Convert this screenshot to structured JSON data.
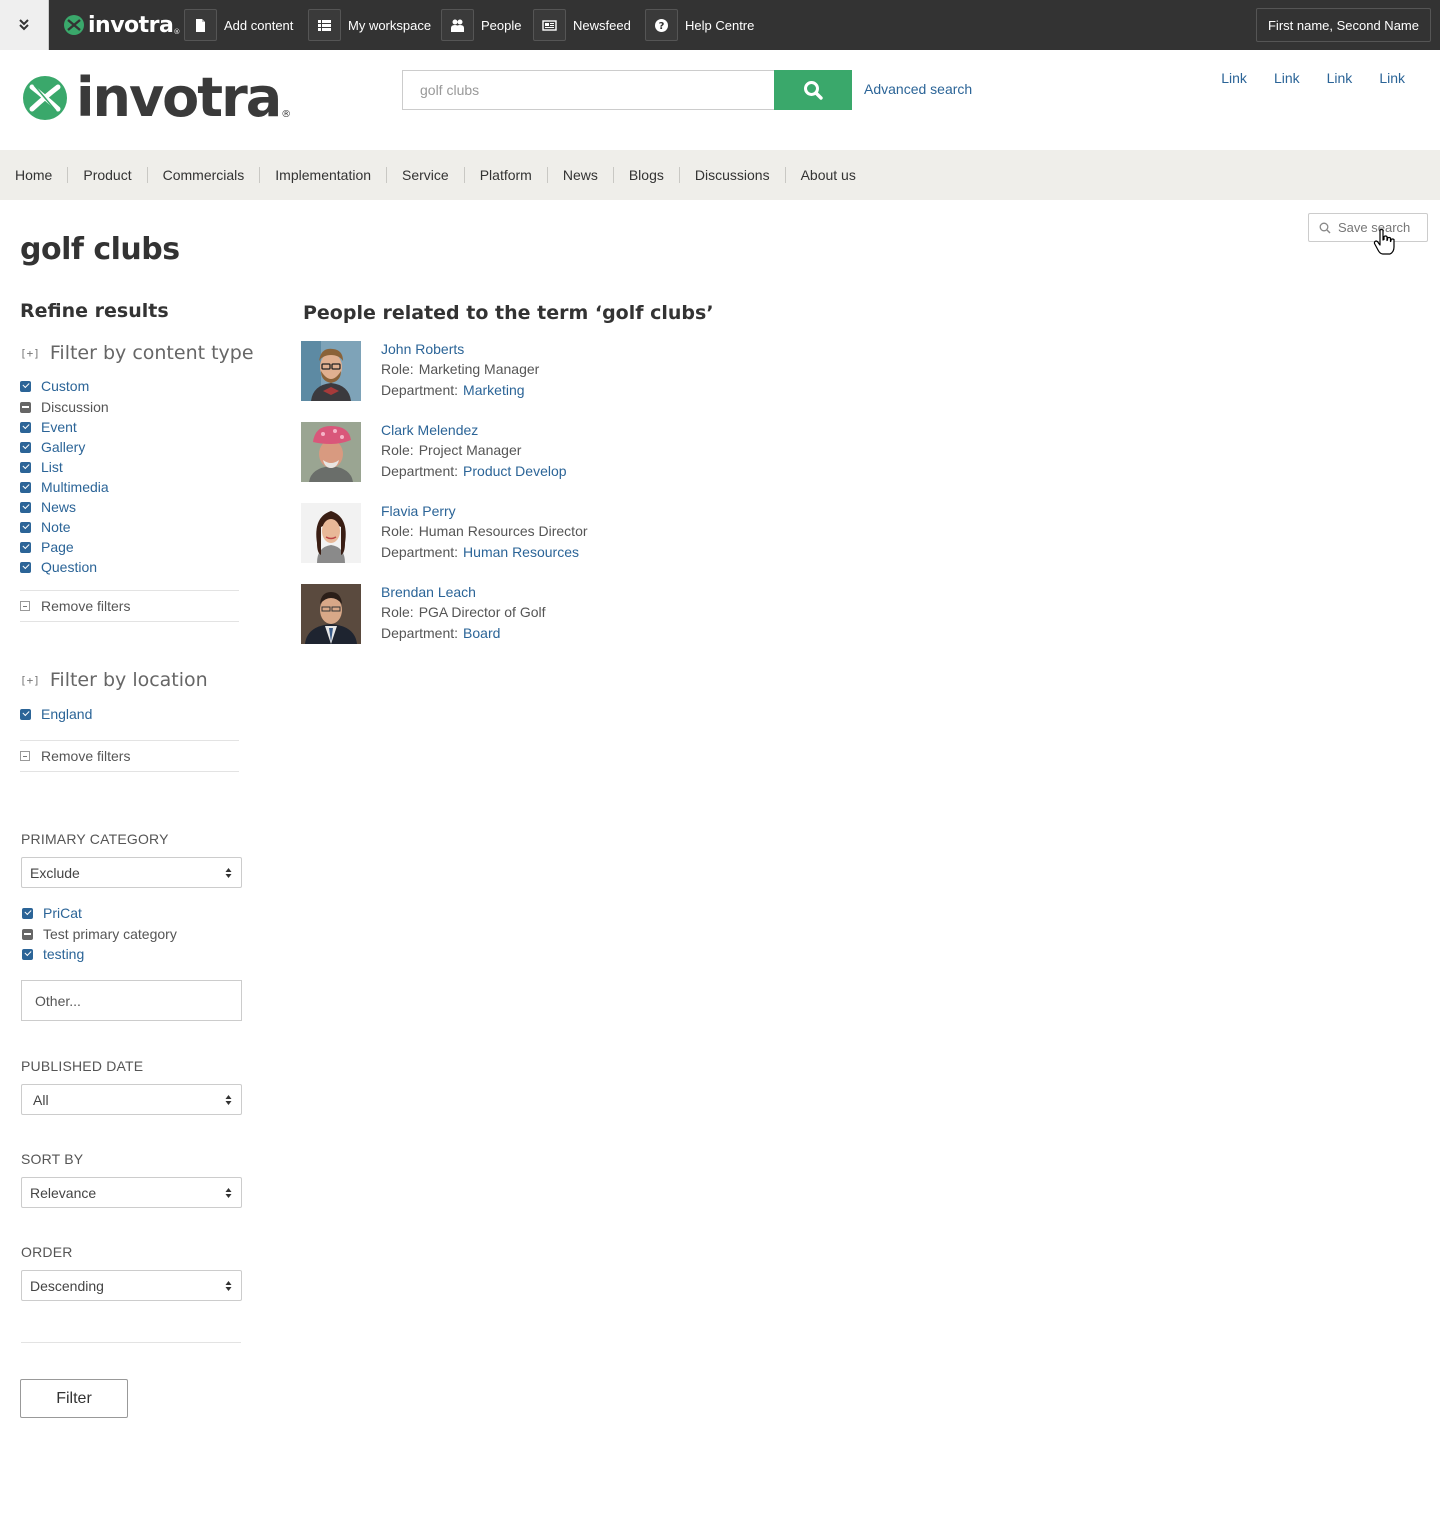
{
  "toolbar": {
    "logo_text": "invotra",
    "logo_reg": "®",
    "items": [
      {
        "label": "Add content",
        "icon": "document-icon"
      },
      {
        "label": "My workspace",
        "icon": "list-icon"
      },
      {
        "label": "People",
        "icon": "people-icon"
      },
      {
        "label": "Newsfeed",
        "icon": "newspaper-icon"
      },
      {
        "label": "Help Centre",
        "icon": "help-icon"
      }
    ],
    "user_name": "First name, Second Name"
  },
  "header": {
    "logo_text": "invotra",
    "logo_reg": "®",
    "search_value": "golf clubs",
    "advanced_search": "Advanced search",
    "links": [
      "Link",
      "Link",
      "Link",
      "Link"
    ]
  },
  "nav": [
    "Home",
    "Product",
    "Commercials",
    "Implementation",
    "Service",
    "Platform",
    "News",
    "Blogs",
    "Discussions",
    "About us"
  ],
  "save_search": "Save search",
  "page_title": "golf clubs",
  "sidebar": {
    "refine_title": "Refine results",
    "content_type": {
      "expander": "[+]",
      "title": "Filter by content type",
      "items": [
        {
          "label": "Custom",
          "state": "on"
        },
        {
          "label": "Discussion",
          "state": "partial"
        },
        {
          "label": "Event",
          "state": "on"
        },
        {
          "label": "Gallery",
          "state": "on"
        },
        {
          "label": "List",
          "state": "on"
        },
        {
          "label": "Multimedia",
          "state": "on"
        },
        {
          "label": "News",
          "state": "on"
        },
        {
          "label": "Note",
          "state": "on"
        },
        {
          "label": "Page",
          "state": "on"
        },
        {
          "label": "Question",
          "state": "on"
        }
      ],
      "remove_filters": "Remove filters"
    },
    "location": {
      "expander": "[+]",
      "title": "Filter by location",
      "items": [
        {
          "label": "England",
          "state": "on"
        }
      ],
      "remove_filters": "Remove filters"
    },
    "primary_category": {
      "label": "PRIMARY CATEGORY",
      "selected": "Exclude",
      "items": [
        {
          "label": "PriCat",
          "state": "on"
        },
        {
          "label": "Test primary category",
          "state": "partial"
        },
        {
          "label": "testing",
          "state": "on"
        }
      ],
      "other_placeholder": "Other..."
    },
    "published_date": {
      "label": "PUBLISHED DATE",
      "selected": "All"
    },
    "sort_by": {
      "label": "SORT BY",
      "selected": "Relevance"
    },
    "order": {
      "label": "ORDER",
      "selected": "Descending"
    },
    "filter_button": "Filter"
  },
  "results": {
    "title": "People related to the term ‘golf clubs’",
    "role_key": "Role:",
    "dept_key": "Department:",
    "people": [
      {
        "name": "John Roberts",
        "role": "Marketing Manager",
        "department": "Marketing"
      },
      {
        "name": "Clark Melendez",
        "role": "Project Manager",
        "department": "Product Develop"
      },
      {
        "name": "Flavia Perry",
        "role": "Human Resources Director",
        "department": "Human Resources"
      },
      {
        "name": "Brendan Leach",
        "role": "PGA Director of Golf",
        "department": "Board"
      }
    ]
  },
  "colors": {
    "toolbar_bg": "#333333",
    "brand_green": "#3aa86b",
    "link_blue": "#2b6497",
    "nav_bg": "#efeeea"
  }
}
